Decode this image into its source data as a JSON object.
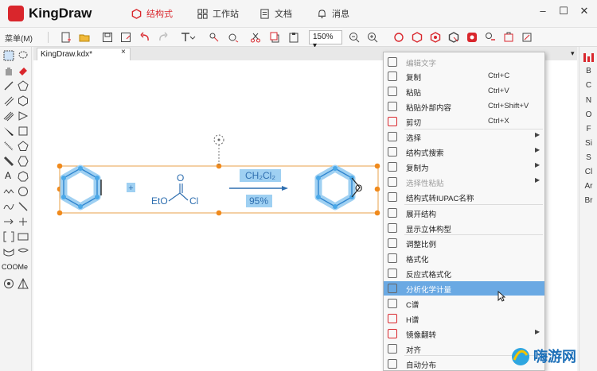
{
  "app": {
    "title": "KingDraw"
  },
  "nav": {
    "tabs": [
      {
        "label": "结构式",
        "active": true
      },
      {
        "label": "工作站",
        "active": false
      },
      {
        "label": "文档",
        "active": false
      },
      {
        "label": "消息",
        "active": false
      }
    ]
  },
  "toolbar": {
    "menu_label": "菜单(M)",
    "zoom": "150%"
  },
  "document": {
    "tab_label": "KingDraw.kdx*",
    "close": "×"
  },
  "canvas": {
    "plus": "+",
    "reagent_left": "EtO",
    "reagent_o": "O",
    "reagent_right": "Cl",
    "condition_top": "CH₂Cl₂",
    "condition_bottom": "95%",
    "product_o": "O"
  },
  "left_tools": {
    "label_a": "A",
    "label_coome": "COOMe"
  },
  "elements": [
    "B",
    "C",
    "N",
    "O",
    "F",
    "Si",
    "S",
    "Cl",
    "Ar",
    "Br"
  ],
  "context_menu": {
    "items": [
      {
        "label": "编辑文字",
        "shortcut": "",
        "arrow": false,
        "disabled": true
      },
      {
        "label": "复制",
        "shortcut": "Ctrl+C",
        "arrow": false,
        "disabled": false
      },
      {
        "label": "粘贴",
        "shortcut": "Ctrl+V",
        "arrow": false,
        "disabled": false
      },
      {
        "label": "粘贴外部内容",
        "shortcut": "Ctrl+Shift+V",
        "arrow": false,
        "disabled": false
      },
      {
        "label": "剪切",
        "shortcut": "Ctrl+X",
        "arrow": false,
        "disabled": false
      },
      {
        "label": "选择",
        "shortcut": "",
        "arrow": true,
        "disabled": false
      },
      {
        "label": "结构式搜索",
        "shortcut": "",
        "arrow": true,
        "disabled": false
      },
      {
        "label": "复制为",
        "shortcut": "",
        "arrow": true,
        "disabled": false
      },
      {
        "label": "选择性粘贴",
        "shortcut": "",
        "arrow": true,
        "disabled": true
      },
      {
        "label": "结构式转IUPAC名称",
        "shortcut": "",
        "arrow": false,
        "disabled": false
      },
      {
        "label": "展开结构",
        "shortcut": "",
        "arrow": false,
        "disabled": false
      },
      {
        "label": "显示立体构型",
        "shortcut": "",
        "arrow": false,
        "disabled": false
      },
      {
        "label": "调整比例",
        "shortcut": "",
        "arrow": false,
        "disabled": false
      },
      {
        "label": "格式化",
        "shortcut": "",
        "arrow": false,
        "disabled": false
      },
      {
        "label": "反应式格式化",
        "shortcut": "",
        "arrow": false,
        "disabled": false
      },
      {
        "label": "分析化学计量",
        "shortcut": "",
        "arrow": false,
        "disabled": false,
        "highlighted": true
      },
      {
        "label": "C谱",
        "shortcut": "",
        "arrow": false,
        "disabled": false
      },
      {
        "label": "H谱",
        "shortcut": "",
        "arrow": false,
        "disabled": false
      },
      {
        "label": "镜像翻转",
        "shortcut": "",
        "arrow": true,
        "disabled": false
      },
      {
        "label": "对齐",
        "shortcut": "",
        "arrow": false,
        "disabled": false
      },
      {
        "label": "自动分布",
        "shortcut": "",
        "arrow": false,
        "disabled": false
      }
    ]
  },
  "watermark": {
    "text": "嗨游网"
  }
}
